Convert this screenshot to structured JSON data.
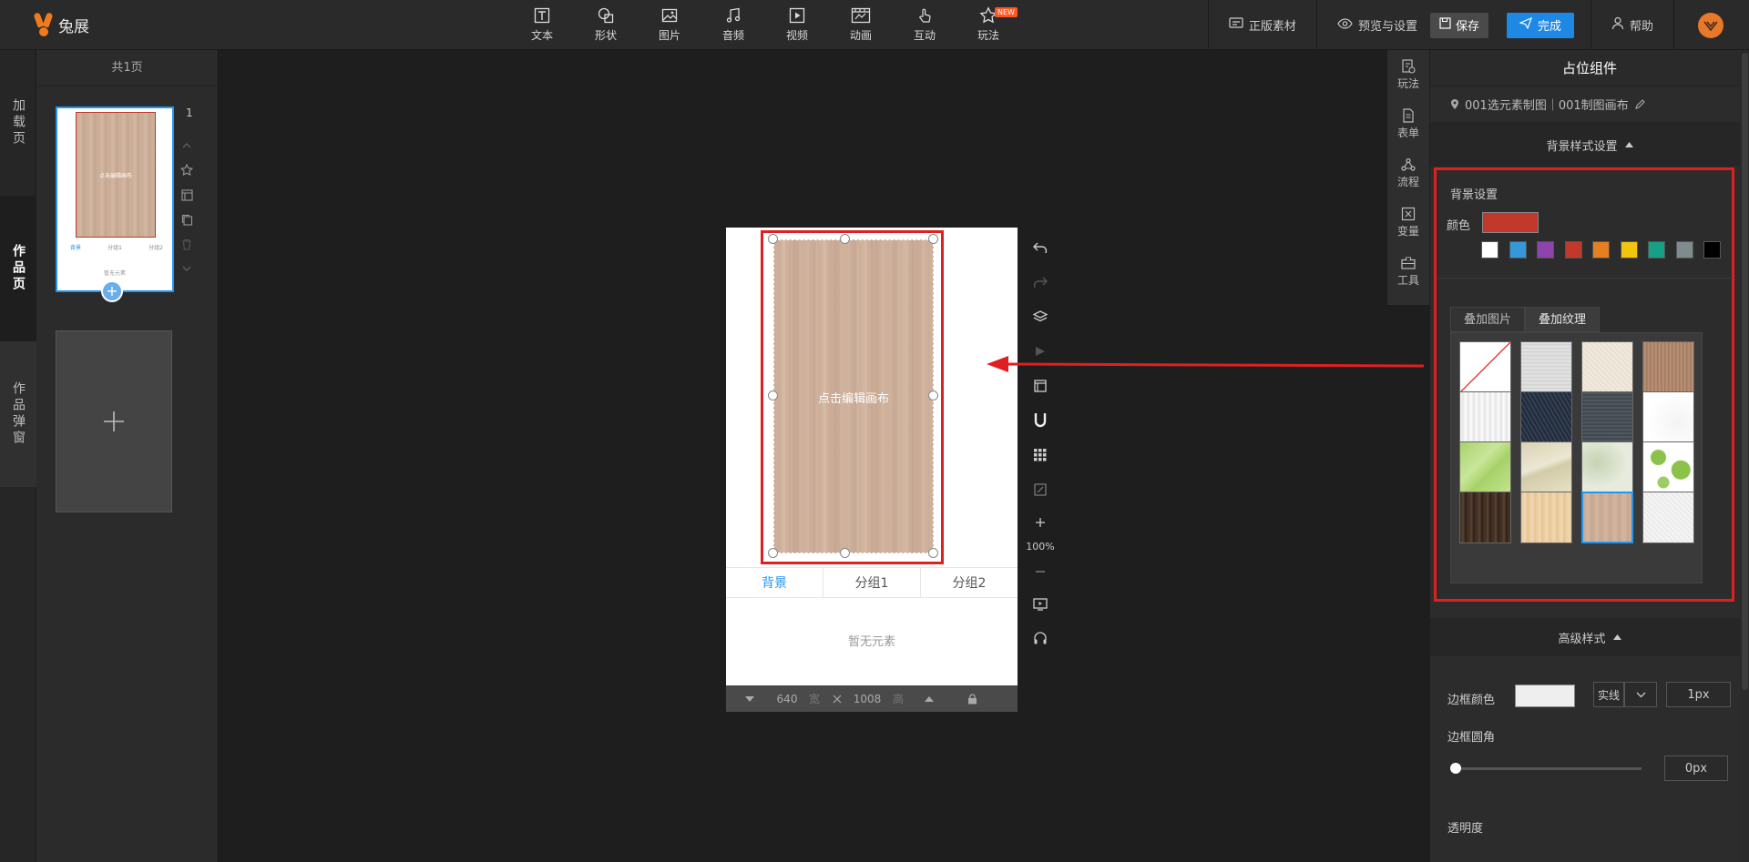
{
  "app": {
    "logo_text": "兔展"
  },
  "toolbar": {
    "items": [
      {
        "label": "文本",
        "icon": "text-icon"
      },
      {
        "label": "形状",
        "icon": "shape-icon"
      },
      {
        "label": "图片",
        "icon": "image-icon"
      },
      {
        "label": "音频",
        "icon": "music-icon"
      },
      {
        "label": "视频",
        "icon": "video-icon"
      },
      {
        "label": "动画",
        "icon": "animation-icon"
      },
      {
        "label": "互动",
        "icon": "touch-icon"
      },
      {
        "label": "玩法",
        "icon": "star-icon"
      }
    ],
    "new_badge": "NEW"
  },
  "top_right": {
    "materials": "正版素材",
    "preview": "预览与设置",
    "save": "保存",
    "done": "完成",
    "help": "帮助"
  },
  "vtabs": [
    "加载页",
    "作品页",
    "作品弹窗"
  ],
  "pages": {
    "header": "共1页",
    "page_number": "1",
    "thumb_label": "点击编辑画布",
    "thumb_tabs": [
      "背景",
      "分组1",
      "分组2"
    ],
    "thumb_empty": "暂无元素"
  },
  "canvas": {
    "wood_label": "点击编辑画布",
    "tabs": [
      "背景",
      "分组1",
      "分组2"
    ],
    "empty_text": "暂无元素",
    "width": "640",
    "width_unit": "宽",
    "height": "1008",
    "height_unit": "高",
    "zoom": "100%"
  },
  "right_strip": [
    "玩法",
    "表单",
    "流程",
    "变量",
    "工具"
  ],
  "panel": {
    "title": "占位组件",
    "path": "001选元素制图｜001制图画布",
    "bg_style_section": "背景样式设置",
    "bg_settings": "背景设置",
    "color_label": "颜色",
    "current_color": "#c0392b",
    "swatches": [
      "#ffffff",
      "#3498db",
      "#8e44ad",
      "#c0392b",
      "#e67e22",
      "#f1c40f",
      "#16a085",
      "#7f8c8d",
      "#000000"
    ],
    "tex_tabs": [
      "叠加图片",
      "叠加纹理"
    ],
    "advanced_section": "高级样式",
    "border_color_label": "边框颜色",
    "border_style": "实线",
    "border_width": "1px",
    "border_radius_label": "边框圆角",
    "border_radius": "0px",
    "border_radius_value": 0,
    "opacity_label": "透明度"
  }
}
